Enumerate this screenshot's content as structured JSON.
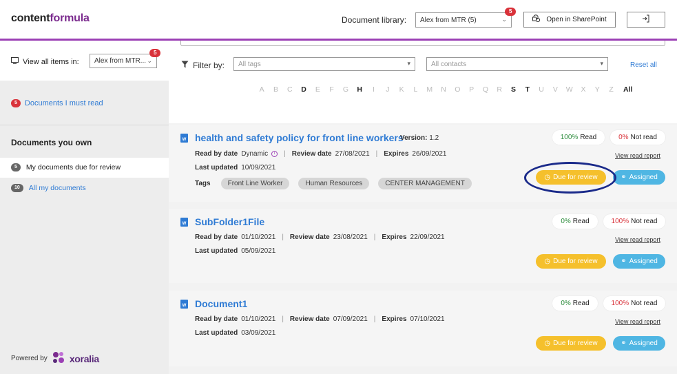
{
  "brand": {
    "part1": "content",
    "part2": "formula"
  },
  "header": {
    "doc_library_label": "Document library:",
    "doc_library_value": "Alex from MTR (5)",
    "doc_library_badge": "5",
    "sharepoint_label": "Open in SharePoint"
  },
  "sidebar": {
    "view_all_label": "View all items in:",
    "view_all_value": "Alex from MTR...",
    "view_all_badge": "5",
    "must_read_badge": "5",
    "must_read_label": "Documents I must read",
    "own_title": "Documents you own",
    "due_review_badge": "5",
    "due_review_label": "My documents due for review",
    "all_docs_badge": "10",
    "all_docs_label": "All my documents",
    "powered_by": "Powered by",
    "powered_brand": "xoralia"
  },
  "filters": {
    "filter_label": "Filter by:",
    "tags_placeholder": "All tags",
    "contacts_placeholder": "All contacts",
    "reset_label": "Reset all",
    "alphabet": [
      "A",
      "B",
      "C",
      "D",
      "E",
      "F",
      "G",
      "H",
      "I",
      "J",
      "K",
      "L",
      "M",
      "N",
      "O",
      "P",
      "Q",
      "R",
      "S",
      "T",
      "U",
      "V",
      "W",
      "X",
      "Y",
      "Z",
      "All"
    ],
    "alphabet_active": [
      "D",
      "H",
      "S",
      "T",
      "All"
    ]
  },
  "documents": [
    {
      "title": "health and safety policy for front line workers",
      "version_label": "Version:",
      "version": "1.2",
      "read_by_label": "Read by date",
      "read_by": "Dynamic",
      "review_label": "Review date",
      "review": "27/08/2021",
      "expires_label": "Expires",
      "expires": "26/09/2021",
      "updated_label": "Last updated",
      "updated": "10/09/2021",
      "tags_label": "Tags",
      "tags": [
        "Front Line Worker",
        "Human Resources",
        "CENTER MANAGEMENT"
      ],
      "read_pct": "100%",
      "read_word": "Read",
      "notread_pct": "0%",
      "notread_word": "Not read",
      "report_label": "View read report",
      "due_label": "Due for review",
      "assigned_label": "Assigned"
    },
    {
      "title": "SubFolder1File",
      "read_by_label": "Read by date",
      "read_by": "01/10/2021",
      "review_label": "Review date",
      "review": "23/08/2021",
      "expires_label": "Expires",
      "expires": "22/09/2021",
      "updated_label": "Last updated",
      "updated": "05/09/2021",
      "read_pct": "0%",
      "read_word": "Read",
      "notread_pct": "100%",
      "notread_word": "Not read",
      "report_label": "View read report",
      "due_label": "Due for review",
      "assigned_label": "Assigned"
    },
    {
      "title": "Document1",
      "read_by_label": "Read by date",
      "read_by": "01/10/2021",
      "review_label": "Review date",
      "review": "07/09/2021",
      "expires_label": "Expires",
      "expires": "07/10/2021",
      "updated_label": "Last updated",
      "updated": "03/09/2021",
      "read_pct": "0%",
      "read_word": "Read",
      "notread_pct": "100%",
      "notread_word": "Not read",
      "report_label": "View read report",
      "due_label": "Due for review",
      "assigned_label": "Assigned"
    }
  ],
  "colors": {
    "brand_purple": "#9b3fb5",
    "link_blue": "#2f7bd4",
    "due_yellow": "#f5c02c",
    "assigned_blue": "#4fb6e3",
    "badge_red": "#d9323a",
    "annotation_circle": "#1a2a8a"
  }
}
